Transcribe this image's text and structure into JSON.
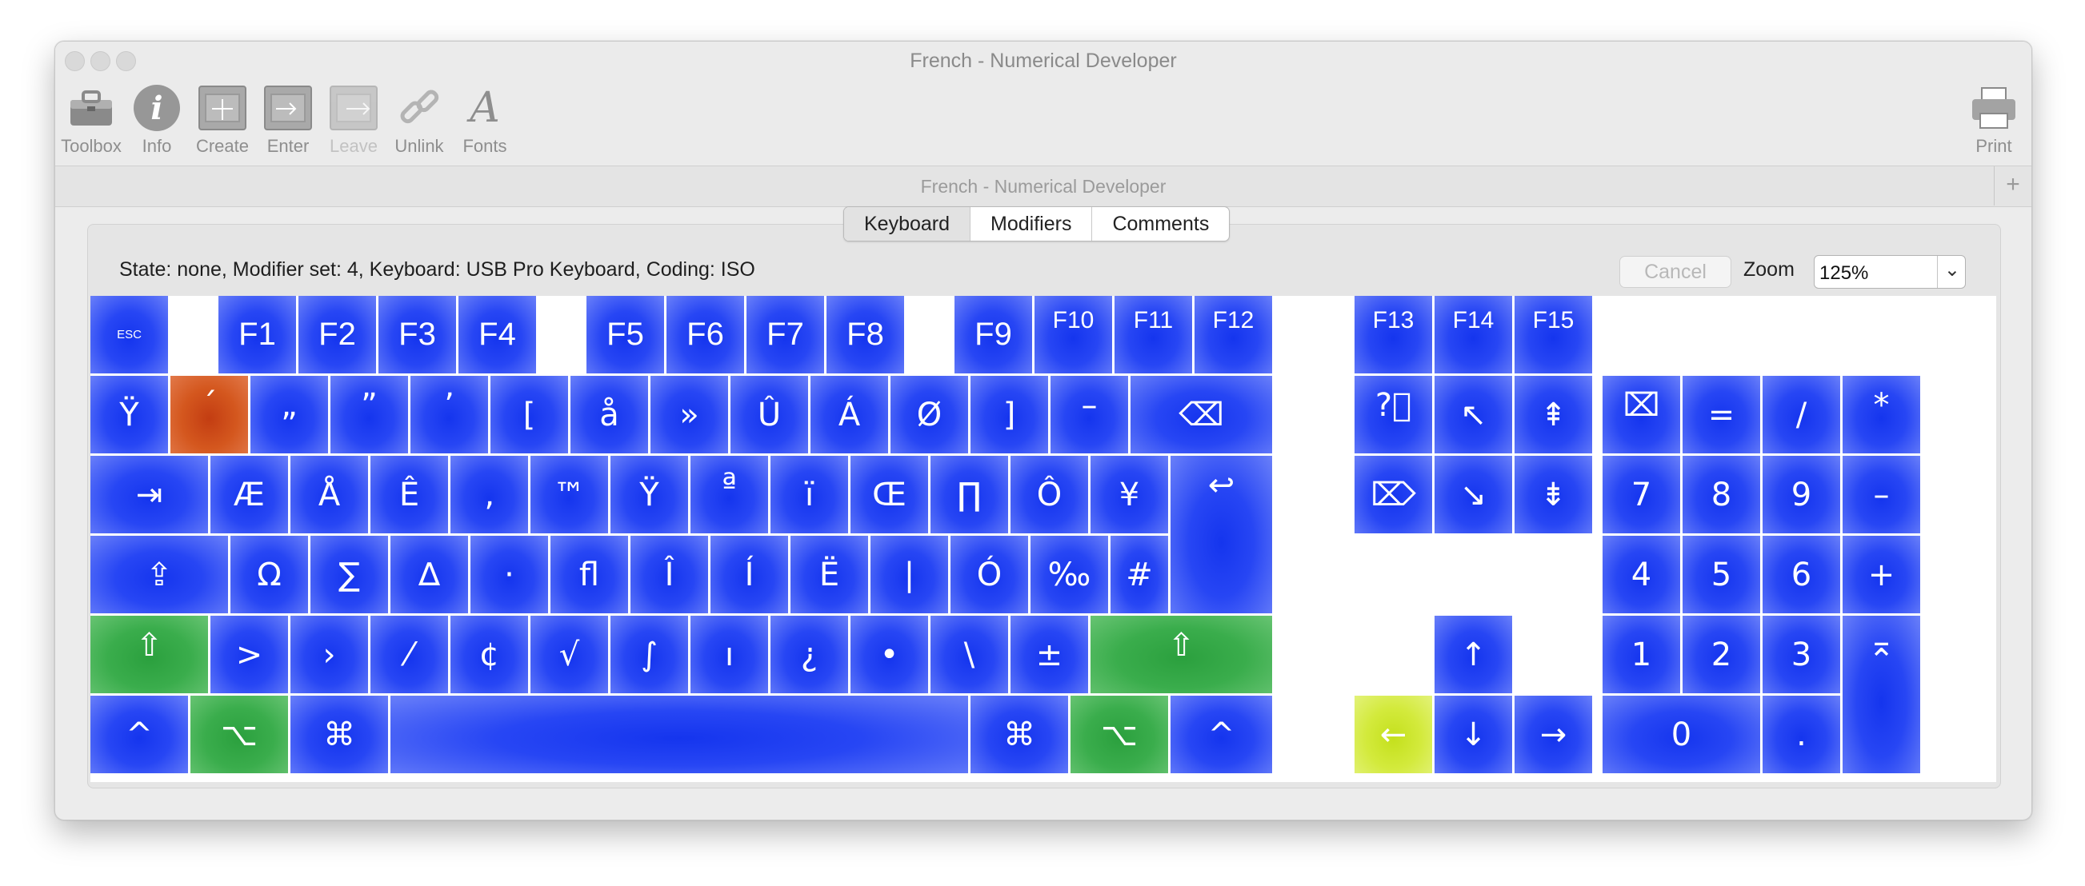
{
  "window": {
    "title": "French - Numerical Developer",
    "document_title": "French - Numerical Developer",
    "plus_label": "+"
  },
  "toolbar": {
    "toolbox": "Toolbox",
    "info": "Info",
    "create": "Create",
    "enter": "Enter",
    "leave": "Leave",
    "unlink": "Unlink",
    "fonts": "Fonts",
    "fonts_glyph": "A",
    "info_glyph": "i",
    "print": "Print"
  },
  "tabs": {
    "keyboard": "Keyboard",
    "modifiers": "Modifiers",
    "comments": "Comments",
    "active": "Keyboard"
  },
  "status": {
    "text": "State: none, Modifier set: 4, Keyboard: USB Pro Keyboard, Coding: ISO"
  },
  "controls": {
    "cancel": "Cancel",
    "zoom_label": "Zoom",
    "zoom_value": "125%",
    "zoom_chevron": "⌄"
  },
  "colors": {
    "key_blue": "#2746f4",
    "dead_key_orange": "#d4571e",
    "active_modifier_green": "#3aad4c",
    "selected_key_yellow": "#d3ea3c"
  },
  "keys": {
    "fn_row": [
      "ESC",
      "F1",
      "F2",
      "F3",
      "F4",
      "F5",
      "F6",
      "F7",
      "F8",
      "F9",
      "F10",
      "F11",
      "F12",
      "F13",
      "F14",
      "F15"
    ],
    "row1": [
      "Ÿ",
      "´",
      "„",
      "”",
      "’",
      "[",
      "å",
      "»",
      "Û",
      "Á",
      "Ø",
      "]",
      "–",
      "⌫"
    ],
    "row2": [
      "⇥",
      "Æ",
      "Å",
      "Ê",
      "‚",
      "™",
      "Ÿ",
      "ª",
      "ï",
      "Œ",
      "∏",
      "Ô",
      "¥",
      "↩"
    ],
    "row3": [
      "⇪",
      "Ω",
      "∑",
      "∆",
      "·",
      "ﬂ",
      "Î",
      "Í",
      "Ë",
      "|",
      "Ó",
      "‰",
      "#"
    ],
    "row4": [
      "⇧",
      ">",
      "›",
      "⁄",
      "¢",
      "√",
      "∫",
      "ı",
      "¿",
      "•",
      "\\",
      "±",
      "⇧"
    ],
    "row5": [
      "^",
      "⌥",
      "⌘",
      "",
      "⌘",
      "⌥",
      "^"
    ],
    "nav": [
      "?⃝",
      "↖",
      "⇞",
      "⌦",
      "↘",
      "⇟",
      "↑",
      "←",
      "↓",
      "→"
    ],
    "numpad": [
      "⌧",
      "=",
      "/",
      "*",
      "7",
      "8",
      "9",
      "–",
      "4",
      "5",
      "6",
      "+",
      "1",
      "2",
      "3",
      "⌅",
      "0",
      "."
    ]
  }
}
